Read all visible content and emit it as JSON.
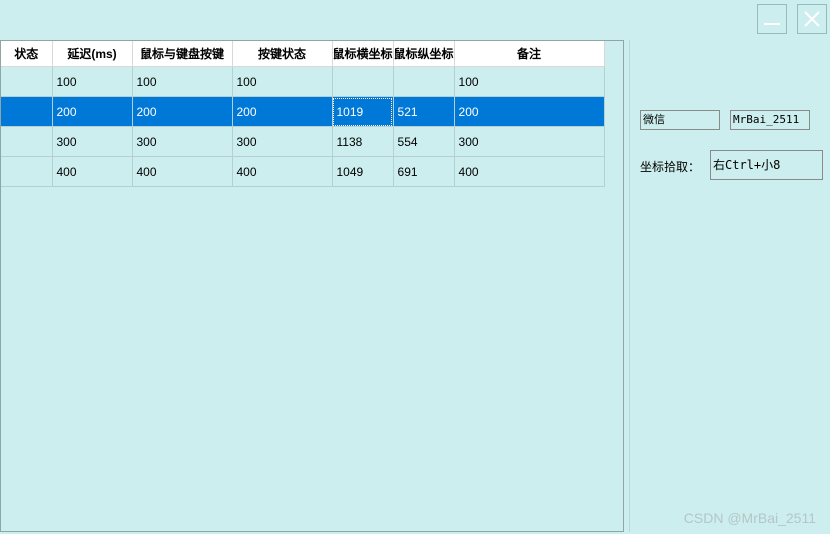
{
  "window": {
    "minimize_icon": "minimize-icon",
    "close_icon": "close-icon"
  },
  "grid": {
    "columns": [
      "状态",
      "延迟(ms)",
      "鼠标与键盘按键",
      "按键状态",
      "鼠标横坐标",
      "鼠标纵坐标",
      "备注"
    ],
    "rows": [
      [
        "",
        "100",
        "100",
        "100",
        "",
        "",
        "100"
      ],
      [
        "",
        "200",
        "200",
        "200",
        "1019",
        "521",
        "200"
      ],
      [
        "",
        "300",
        "300",
        "300",
        "1138",
        "554",
        "300"
      ],
      [
        "",
        "400",
        "400",
        "400",
        "1049",
        "691",
        "400"
      ]
    ],
    "selected_row": 1
  },
  "side": {
    "wechat_field": "微信",
    "wechat_id_field": "MrBai_2511",
    "coord_label": "坐标拾取：",
    "coord_hotkey_field": "右Ctrl+小8"
  },
  "watermark": "CSDN @MrBai_2511",
  "colors": {
    "background": "#cdeeee",
    "selection": "#0078d7"
  }
}
